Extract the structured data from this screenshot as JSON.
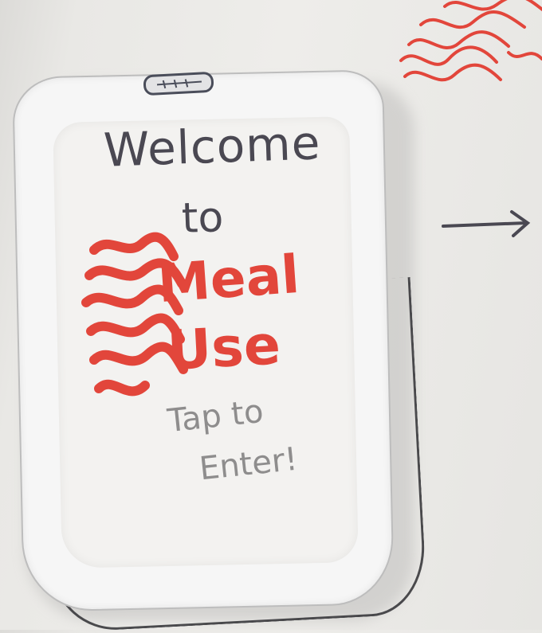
{
  "screen": {
    "title_line1": "Welcome",
    "title_line2": "to",
    "app_name_line1": "Meal",
    "app_name_line2": "Use",
    "cta_line1": "Tap to",
    "cta_line2": "Enter!"
  },
  "colors": {
    "ink_dark": "#4a4852",
    "ink_red": "#e2463b",
    "ink_gray": "#8e8d8d",
    "paper": "#f3f2f0"
  },
  "icons": {
    "logo": "noodles-icon",
    "next": "arrow-right-icon",
    "speaker": "speaker-slot-icon"
  }
}
